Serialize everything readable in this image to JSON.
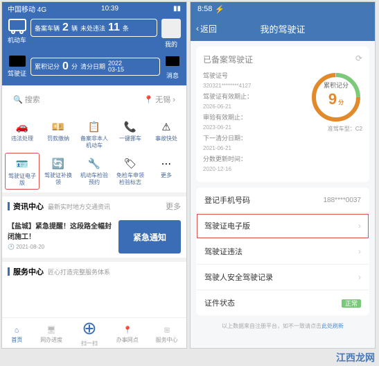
{
  "left": {
    "status": {
      "carrier": "中国移动",
      "net": "4G",
      "time": "10:39"
    },
    "header": {
      "car_label": "机动车",
      "stat1_a": "备案车辆",
      "stat1_av": "2",
      "stat1_b": "未处违法",
      "stat1_bv": "11",
      "stat1_unit": "辆",
      "profile": "我的",
      "lic_label": "驾驶证",
      "stat2_a": "累积记分",
      "stat2_av": "0",
      "stat2_b": "清分日期",
      "stat2_bv": "2022",
      "stat2_bv2": "03-15",
      "msg_label": "消息"
    },
    "search": {
      "placeholder": "搜索",
      "city": "无锡"
    },
    "grid": [
      {
        "label": "违法处理"
      },
      {
        "label": "罚款缴纳"
      },
      {
        "label": "备案非本人机动车"
      },
      {
        "label": "一键挪车"
      },
      {
        "label": "事故快处"
      },
      {
        "label": "驾驶证电子版",
        "hl": true
      },
      {
        "label": "驾驶证补换领"
      },
      {
        "label": "机动车检验预约"
      },
      {
        "label": "免检车申领检验标志"
      },
      {
        "label": "更多"
      }
    ],
    "news": {
      "sec": "资讯中心",
      "sub": "最新实时地方交通资讯",
      "more": "更多",
      "title": "【盐城】紧急提醒！这段路全幅封闭施工！",
      "date": "2021-08-20",
      "box": "紧急通知"
    },
    "service": {
      "sec": "服务中心",
      "sub": "匠心打造完整服务体系"
    },
    "tabs": [
      "首页",
      "网办进度",
      "扫一扫",
      "办事网点",
      "服务中心"
    ]
  },
  "right": {
    "status_time": "8:58",
    "nav": {
      "back": "返回",
      "title": "我的驾驶证"
    },
    "card": {
      "title": "已备案驾驶证",
      "lic_no_lbl": "驾驶证号",
      "lic_no": "320321********4127",
      "exp_lbl": "驾驶证有效期止：",
      "exp": "2026-06-21",
      "audit_lbl": "审验有效期止：",
      "audit": "2023-06-21",
      "next_lbl": "下一清分日期：",
      "next": "2021-06-21",
      "upd_lbl": "分数更新时间：",
      "upd": "2020-12-16",
      "ring_lbl": "累积记分",
      "ring_val": "9",
      "ring_unit": "分",
      "cartype": "准驾车型：C2"
    },
    "list": [
      {
        "label": "登记手机号码",
        "val": "188****0037"
      },
      {
        "label": "驾驶证电子版",
        "hl": true,
        "arrow": true
      },
      {
        "label": "驾驶证违法",
        "arrow": true
      },
      {
        "label": "驾驶人安全驾驶记录",
        "arrow": true
      },
      {
        "label": "证件状态",
        "badge": "正常"
      }
    ],
    "foot": {
      "text": "以上数据来自注册平台，如不一致请点击",
      "link": "此处刷新"
    }
  },
  "watermark": "江西龙网"
}
